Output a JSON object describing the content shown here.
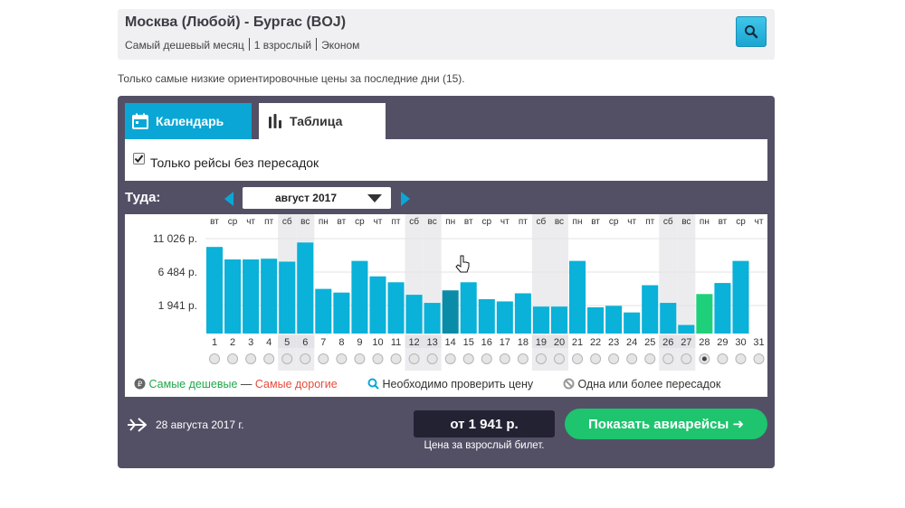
{
  "search": {
    "route": "Москва (Любой) - Бургас (BOJ)",
    "month_type": "Самый дешевый месяц",
    "passengers": "1 взрослый",
    "cabin": "Эконом"
  },
  "hint": "Только самые низкие ориентировочные цены за последние дни (15).",
  "tabs": [
    {
      "label": "Календарь",
      "icon": "calendar-icon"
    },
    {
      "label": "Таблица",
      "icon": "bar-chart-icon"
    }
  ],
  "filter": {
    "label": "Только рейсы без пересадок",
    "checked": true
  },
  "direction_label": "Туда:",
  "month": "август 2017",
  "chart_data": {
    "type": "bar",
    "y_ticks": [
      {
        "label": "11 026 р.",
        "value": 11026
      },
      {
        "label": "6 484 р.",
        "value": 6484
      },
      {
        "label": "1 941 р.",
        "value": 1941
      }
    ],
    "days": [
      "1",
      "2",
      "3",
      "4",
      "5",
      "6",
      "7",
      "8",
      "9",
      "10",
      "11",
      "12",
      "13",
      "14",
      "15",
      "16",
      "17",
      "18",
      "19",
      "20",
      "21",
      "22",
      "23",
      "24",
      "25",
      "26",
      "27",
      "28",
      "29",
      "30",
      "31"
    ],
    "weekdays": [
      "вт",
      "ср",
      "чт",
      "пт",
      "сб",
      "вс",
      "пн",
      "вт",
      "ср",
      "чт",
      "пт",
      "сб",
      "вс",
      "пн",
      "вт",
      "ср",
      "чт",
      "пт",
      "сб",
      "вс",
      "пн",
      "вт",
      "ср",
      "чт",
      "пт",
      "сб",
      "вс",
      "пн",
      "вт",
      "ср",
      "чт"
    ],
    "weekend_days": [
      5,
      6,
      12,
      13,
      19,
      20,
      26,
      27
    ],
    "values": [
      9900,
      8200,
      8200,
      8300,
      7900,
      10500,
      4200,
      3700,
      8000,
      5900,
      5100,
      3400,
      2300,
      4000,
      5100,
      2800,
      2500,
      3600,
      1800,
      1800,
      8000,
      1700,
      1900,
      1000,
      4700,
      2300,
      -700,
      3500,
      5000,
      8000
    ],
    "selected_day": 28,
    "cheapest_day": 28,
    "colors": {
      "bar": "#0ab1d8",
      "bar_dark": "#0a8ca8",
      "cheapest": "#1fd07a",
      "weekend_col": "#ececef"
    }
  },
  "legend": {
    "cheapest": "Самые дешевые",
    "dash": "—",
    "expensive": "Самые дорогие",
    "check_price": "Необходимо проверить цену",
    "transfers": "Одна или более пересадок"
  },
  "footer": {
    "date": "28 августа 2017 г.",
    "price": "от 1 941 р.",
    "price_note": "Цена за взрослый билет.",
    "show_button": "Показать авиарейсы ➜"
  }
}
